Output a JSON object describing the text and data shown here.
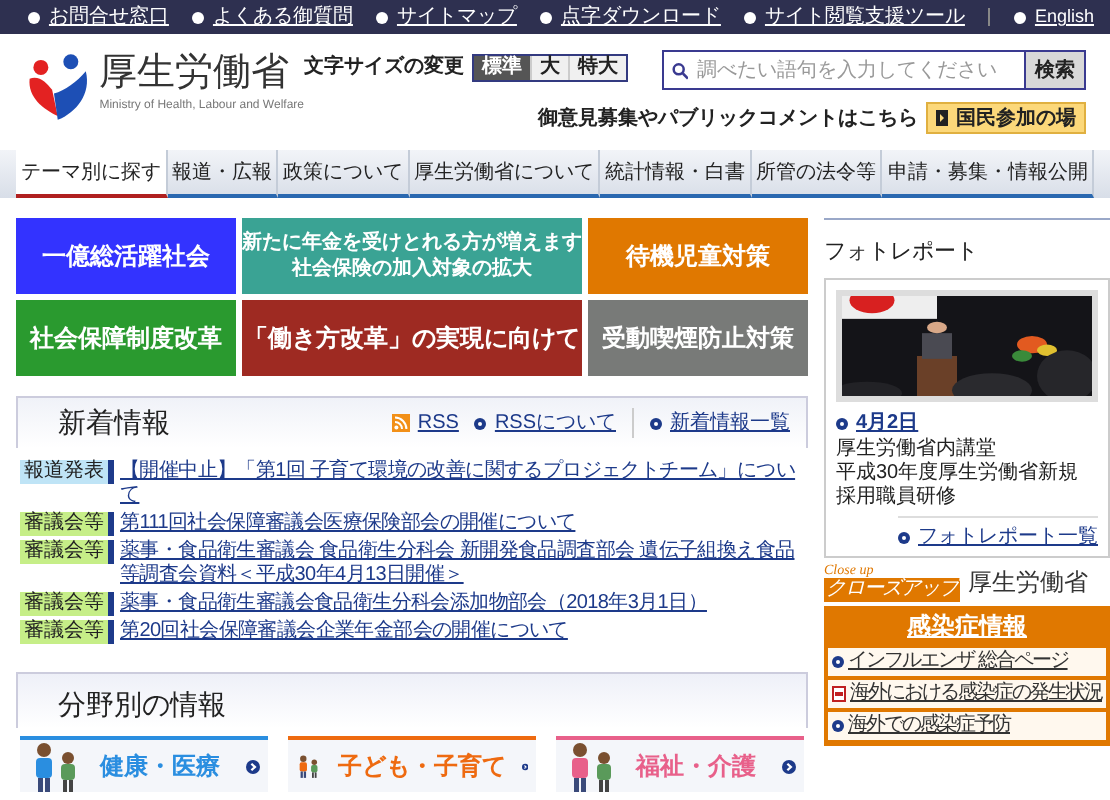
{
  "top_links": [
    {
      "label": "お問合せ窓口"
    },
    {
      "label": "よくある御質問"
    },
    {
      "label": "サイトマップ"
    },
    {
      "label": "点字ダウンロード"
    },
    {
      "label": "サイト閲覧支援ツール"
    }
  ],
  "english": "English",
  "logo": {
    "name": "厚生労働省",
    "subtitle": "Ministry of Health, Labour and Welfare"
  },
  "font_size": {
    "label": "文字サイズの変更",
    "options": [
      {
        "label": "標準",
        "selected": true
      },
      {
        "label": "大",
        "selected": false
      },
      {
        "label": "特大",
        "selected": false
      }
    ]
  },
  "search": {
    "placeholder": "調べたい語句を入力してください",
    "button": "検索"
  },
  "public_comment": {
    "text": "御意見募集やパブリックコメントはこちら",
    "button": "国民参加の場"
  },
  "nav": [
    {
      "label": "テーマ別に探す",
      "selected": true
    },
    {
      "label": "報道・広報",
      "selected": false
    },
    {
      "label": "政策について",
      "selected": false
    },
    {
      "label": "厚生労働省について",
      "selected": false
    },
    {
      "label": "統計情報・白書",
      "selected": false
    },
    {
      "label": "所管の法令等",
      "selected": false
    },
    {
      "label": "申請・募集・情報公開",
      "selected": false
    }
  ],
  "tiles": [
    {
      "lines": [
        "一億総活躍社会"
      ],
      "color": "#3333ff"
    },
    {
      "lines": [
        "新たに年金を受けとれる方が増えます",
        "社会保険の加入対象の拡大"
      ],
      "color": "#3aa394"
    },
    {
      "lines": [
        "待機児童対策"
      ],
      "color": "#e07800"
    },
    {
      "lines": [
        "社会保障制度改革"
      ],
      "color": "#2a9a2f"
    },
    {
      "lines": [
        "「働き方改革」の実現に向けて"
      ],
      "color": "#9e2a22"
    },
    {
      "lines": [
        "受動喫煙防止対策"
      ],
      "color": "#787a78"
    }
  ],
  "news": {
    "title": "新着情報",
    "rss": "RSS",
    "links": [
      "RSSについて",
      "新着情報一覧"
    ],
    "items": [
      {
        "kind": "press",
        "category": "報道発表",
        "text": "【開催中止】「第1回 子育て環境の改善に関するプロジェクトチーム」について"
      },
      {
        "kind": "council",
        "category": "審議会等",
        "text": "第111回社会保障審議会医療保険部会の開催について"
      },
      {
        "kind": "council",
        "category": "審議会等",
        "text": "薬事・食品衛生審議会 食品衛生分科会 新開発食品調査部会 遺伝子組換え食品等調査会資料＜平成30年4月13日開催＞"
      },
      {
        "kind": "council",
        "category": "審議会等",
        "text": "薬事・食品衛生審議会食品衛生分科会添加物部会（2018年3月1日）"
      },
      {
        "kind": "council",
        "category": "審議会等",
        "text": "第20回社会保障審議会企業年金部会の開催について"
      }
    ]
  },
  "fields": {
    "title": "分野別の情報",
    "items": [
      {
        "label": "健康・医療",
        "color": "#2a8ee0"
      },
      {
        "label": "子ども・子育て",
        "color": "#ee6a10"
      },
      {
        "label": "福祉・介護",
        "color": "#e8608a"
      }
    ]
  },
  "photo_report": {
    "title": "フォトレポート",
    "date": "4月2日",
    "caption": [
      "厚生労働省内講堂",
      "平成30年度厚生労働省新規採用職員研修"
    ],
    "more": "フォトレポート一覧"
  },
  "closeup": {
    "script": "Close up",
    "band": "クローズアップ",
    "name": "厚生労働省"
  },
  "infection": {
    "title": "感染症情報",
    "items": [
      {
        "kind": "link",
        "label": "インフルエンザ 総合ページ"
      },
      {
        "kind": "pdf",
        "label": "海外における感染症の発生状況"
      },
      {
        "kind": "link",
        "label": "海外での感染症予防"
      }
    ]
  }
}
